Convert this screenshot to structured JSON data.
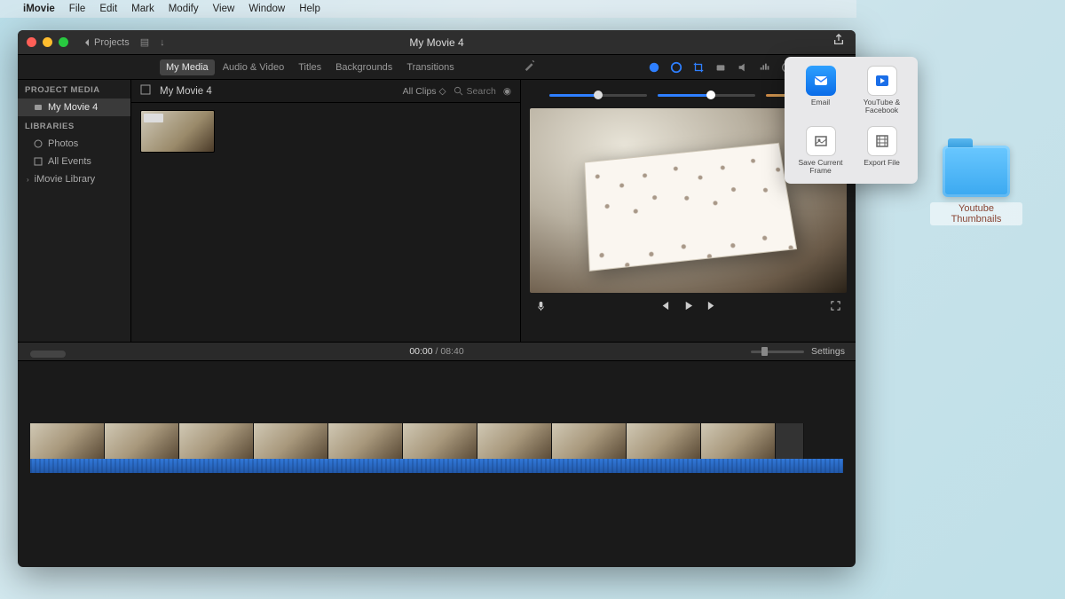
{
  "menubar": {
    "app": "iMovie",
    "items": [
      "File",
      "Edit",
      "Mark",
      "Modify",
      "View",
      "Window",
      "Help"
    ]
  },
  "titlebar": {
    "back_label": "Projects",
    "title": "My Movie 4"
  },
  "library_tabs": [
    "My Media",
    "Audio & Video",
    "Titles",
    "Backgrounds",
    "Transitions"
  ],
  "active_tab": "My Media",
  "sidebar": {
    "project_media_header": "PROJECT MEDIA",
    "project_item": "My Movie 4",
    "libraries_header": "LIBRARIES",
    "photos": "Photos",
    "all_events": "All Events",
    "imovie_library": "iMovie Library"
  },
  "browser": {
    "title": "My Movie 4",
    "filter": "All Clips",
    "search_placeholder": "Search"
  },
  "timecode": {
    "current": "00:00",
    "total": "08:40"
  },
  "settings_label": "Settings",
  "share": {
    "email": "Email",
    "youtube": "YouTube & Facebook",
    "save_frame": "Save Current Frame",
    "export_file": "Export File"
  },
  "desktop": {
    "folder_name": "Youtube Thumbnails"
  }
}
